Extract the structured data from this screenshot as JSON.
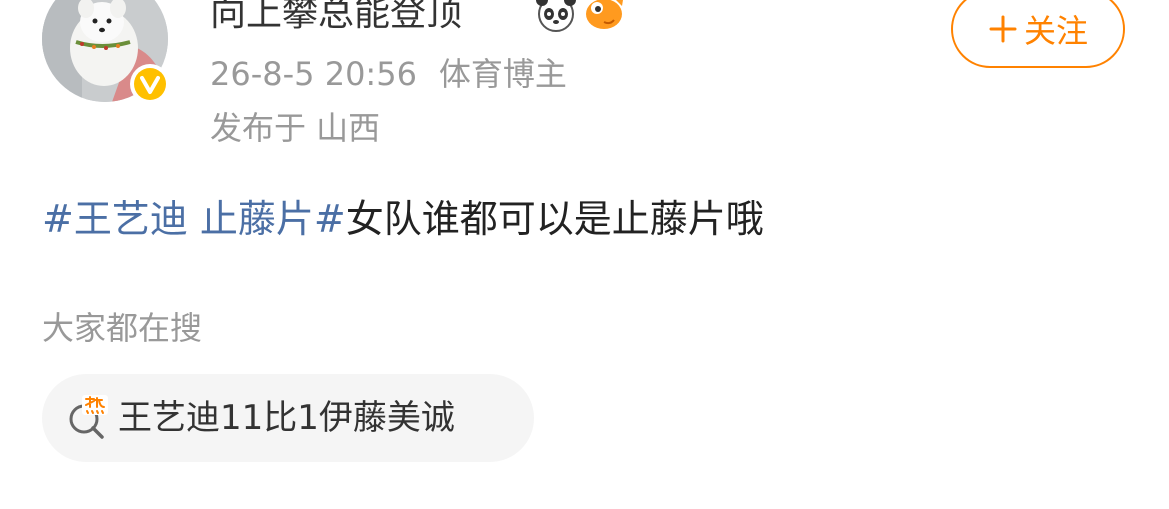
{
  "post": {
    "author": {
      "name": "向上攀总能登顶",
      "badge_icons": [
        "panda-emoji-icon",
        "fish-emoji-icon"
      ]
    },
    "timestamp": "26-8-5 20:56",
    "author_tag": "体育博主",
    "location": "发布于 山西",
    "follow_button": {
      "label": "关注",
      "icon": "plus-icon"
    },
    "topic": "#王艺迪 止藤片#",
    "body": "女队谁都可以是止藤片哦"
  },
  "search": {
    "heading": "大家都在搜",
    "items": [
      {
        "label": "王艺迪11比1伊藤美诚",
        "icon": "hot-search-icon"
      }
    ]
  },
  "colors": {
    "accent": "#ff8200",
    "topic": "#4b6fa5",
    "muted_text": "#999999",
    "chip_bg": "#f5f5f5",
    "verified": "#ffc000"
  }
}
